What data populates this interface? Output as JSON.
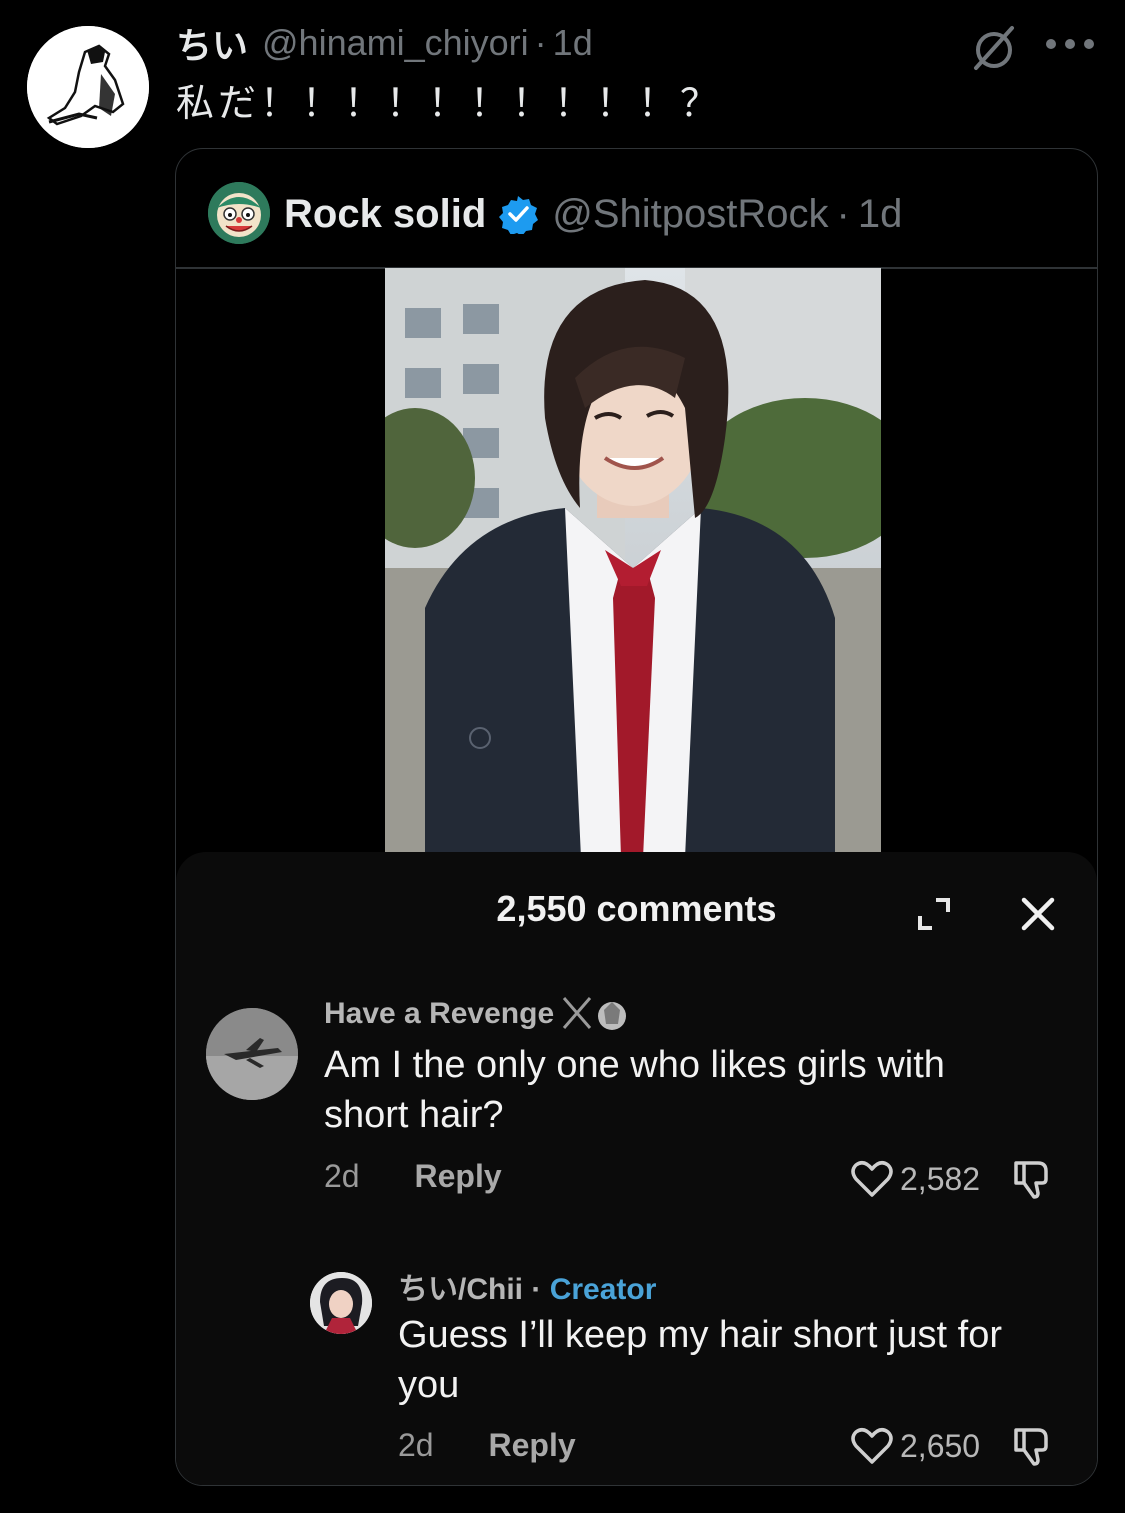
{
  "tweet": {
    "author_name": "ちい",
    "author_handle": "@hinami_chiyori",
    "separator": "·",
    "time": "1d",
    "text": "私だ！！！！！！！！！！？"
  },
  "quote": {
    "author_name": "Rock solid",
    "author_handle": "@ShitpostRock",
    "separator": "·",
    "time": "1d"
  },
  "comments_panel": {
    "title": "2,550 comments",
    "comments": [
      {
        "username": "Have a Revenge",
        "text": "Am I the only one who likes girls with short hair?",
        "age": "2d",
        "reply_label": "Reply",
        "likes": "2,582"
      },
      {
        "username": "ちい/Chii",
        "separator": "·",
        "badge": "Creator",
        "text": "Guess I’ll keep my hair short just for you",
        "age": "2d",
        "reply_label": "Reply",
        "likes": "2,650"
      }
    ]
  },
  "colors": {
    "background": "#000000",
    "secondary_text": "#71767b",
    "verified_blue": "#1d9bf0",
    "creator_badge": "#4aa3d8",
    "panel_bg": "#0b0b0b"
  },
  "icons": [
    "grok-icon",
    "more-icon",
    "verified-badge-icon",
    "expand-icon",
    "close-icon",
    "heart-icon",
    "dislike-icon"
  ]
}
